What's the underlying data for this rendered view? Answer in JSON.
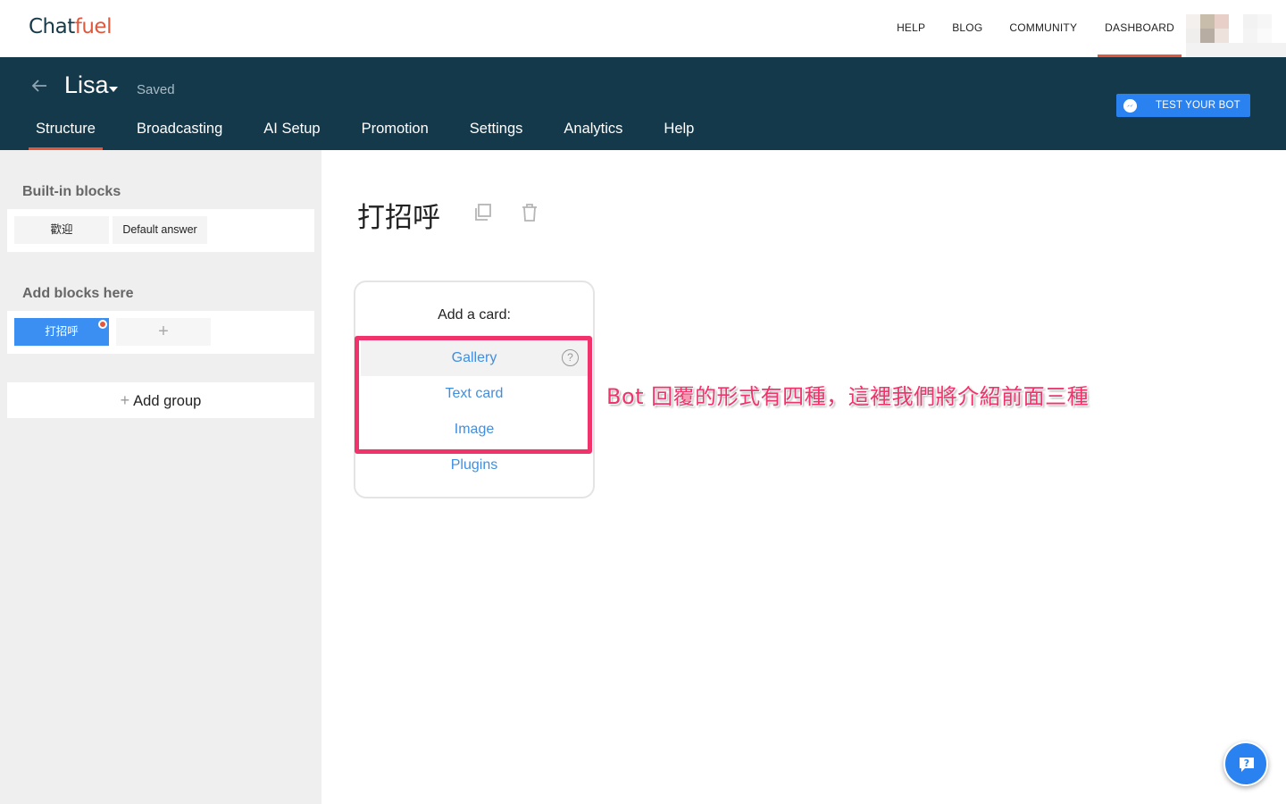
{
  "topnav": {
    "logo_part1": "Chat",
    "logo_part2": "fuel",
    "links": [
      "HELP",
      "BLOG",
      "COMMUNITY",
      "DASHBOARD"
    ],
    "active_link": "DASHBOARD"
  },
  "bot": {
    "name": "Lisa",
    "status": "Saved",
    "test_button": "TEST YOUR BOT",
    "tabs": [
      "Structure",
      "Broadcasting",
      "AI Setup",
      "Promotion",
      "Settings",
      "Analytics",
      "Help"
    ],
    "active_tab": "Structure"
  },
  "sidebar": {
    "builtin_title": "Built-in blocks",
    "builtin_blocks": [
      "歡迎",
      "Default answer"
    ],
    "custom_title": "Add blocks here",
    "custom_blocks": [
      "打招呼"
    ],
    "add_block_symbol": "+",
    "add_group_label": "Add group"
  },
  "main": {
    "block_title": "打招呼",
    "card_title": "Add a card:",
    "card_options": [
      "Gallery",
      "Text card",
      "Image",
      "Plugins"
    ],
    "help_symbol": "?",
    "annotation": "Bot 回覆的形式有四種，這裡我們將介紹前面三種"
  },
  "colors": {
    "header_bg": "#14394b",
    "accent": "#e2573b",
    "primary_blue": "#2a82f0",
    "annotation_pink": "#f0336a"
  }
}
